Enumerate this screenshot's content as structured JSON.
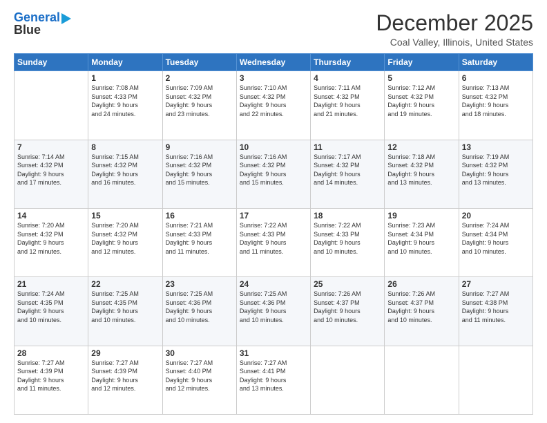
{
  "logo": {
    "line1": "General",
    "line2": "Blue"
  },
  "title": "December 2025",
  "subtitle": "Coal Valley, Illinois, United States",
  "days_header": [
    "Sunday",
    "Monday",
    "Tuesday",
    "Wednesday",
    "Thursday",
    "Friday",
    "Saturday"
  ],
  "weeks": [
    [
      {
        "day": "",
        "info": ""
      },
      {
        "day": "1",
        "info": "Sunrise: 7:08 AM\nSunset: 4:33 PM\nDaylight: 9 hours\nand 24 minutes."
      },
      {
        "day": "2",
        "info": "Sunrise: 7:09 AM\nSunset: 4:32 PM\nDaylight: 9 hours\nand 23 minutes."
      },
      {
        "day": "3",
        "info": "Sunrise: 7:10 AM\nSunset: 4:32 PM\nDaylight: 9 hours\nand 22 minutes."
      },
      {
        "day": "4",
        "info": "Sunrise: 7:11 AM\nSunset: 4:32 PM\nDaylight: 9 hours\nand 21 minutes."
      },
      {
        "day": "5",
        "info": "Sunrise: 7:12 AM\nSunset: 4:32 PM\nDaylight: 9 hours\nand 19 minutes."
      },
      {
        "day": "6",
        "info": "Sunrise: 7:13 AM\nSunset: 4:32 PM\nDaylight: 9 hours\nand 18 minutes."
      }
    ],
    [
      {
        "day": "7",
        "info": "Sunrise: 7:14 AM\nSunset: 4:32 PM\nDaylight: 9 hours\nand 17 minutes."
      },
      {
        "day": "8",
        "info": "Sunrise: 7:15 AM\nSunset: 4:32 PM\nDaylight: 9 hours\nand 16 minutes."
      },
      {
        "day": "9",
        "info": "Sunrise: 7:16 AM\nSunset: 4:32 PM\nDaylight: 9 hours\nand 15 minutes."
      },
      {
        "day": "10",
        "info": "Sunrise: 7:16 AM\nSunset: 4:32 PM\nDaylight: 9 hours\nand 15 minutes."
      },
      {
        "day": "11",
        "info": "Sunrise: 7:17 AM\nSunset: 4:32 PM\nDaylight: 9 hours\nand 14 minutes."
      },
      {
        "day": "12",
        "info": "Sunrise: 7:18 AM\nSunset: 4:32 PM\nDaylight: 9 hours\nand 13 minutes."
      },
      {
        "day": "13",
        "info": "Sunrise: 7:19 AM\nSunset: 4:32 PM\nDaylight: 9 hours\nand 13 minutes."
      }
    ],
    [
      {
        "day": "14",
        "info": "Sunrise: 7:20 AM\nSunset: 4:32 PM\nDaylight: 9 hours\nand 12 minutes."
      },
      {
        "day": "15",
        "info": "Sunrise: 7:20 AM\nSunset: 4:32 PM\nDaylight: 9 hours\nand 12 minutes."
      },
      {
        "day": "16",
        "info": "Sunrise: 7:21 AM\nSunset: 4:33 PM\nDaylight: 9 hours\nand 11 minutes."
      },
      {
        "day": "17",
        "info": "Sunrise: 7:22 AM\nSunset: 4:33 PM\nDaylight: 9 hours\nand 11 minutes."
      },
      {
        "day": "18",
        "info": "Sunrise: 7:22 AM\nSunset: 4:33 PM\nDaylight: 9 hours\nand 10 minutes."
      },
      {
        "day": "19",
        "info": "Sunrise: 7:23 AM\nSunset: 4:34 PM\nDaylight: 9 hours\nand 10 minutes."
      },
      {
        "day": "20",
        "info": "Sunrise: 7:24 AM\nSunset: 4:34 PM\nDaylight: 9 hours\nand 10 minutes."
      }
    ],
    [
      {
        "day": "21",
        "info": "Sunrise: 7:24 AM\nSunset: 4:35 PM\nDaylight: 9 hours\nand 10 minutes."
      },
      {
        "day": "22",
        "info": "Sunrise: 7:25 AM\nSunset: 4:35 PM\nDaylight: 9 hours\nand 10 minutes."
      },
      {
        "day": "23",
        "info": "Sunrise: 7:25 AM\nSunset: 4:36 PM\nDaylight: 9 hours\nand 10 minutes."
      },
      {
        "day": "24",
        "info": "Sunrise: 7:25 AM\nSunset: 4:36 PM\nDaylight: 9 hours\nand 10 minutes."
      },
      {
        "day": "25",
        "info": "Sunrise: 7:26 AM\nSunset: 4:37 PM\nDaylight: 9 hours\nand 10 minutes."
      },
      {
        "day": "26",
        "info": "Sunrise: 7:26 AM\nSunset: 4:37 PM\nDaylight: 9 hours\nand 10 minutes."
      },
      {
        "day": "27",
        "info": "Sunrise: 7:27 AM\nSunset: 4:38 PM\nDaylight: 9 hours\nand 11 minutes."
      }
    ],
    [
      {
        "day": "28",
        "info": "Sunrise: 7:27 AM\nSunset: 4:39 PM\nDaylight: 9 hours\nand 11 minutes."
      },
      {
        "day": "29",
        "info": "Sunrise: 7:27 AM\nSunset: 4:39 PM\nDaylight: 9 hours\nand 12 minutes."
      },
      {
        "day": "30",
        "info": "Sunrise: 7:27 AM\nSunset: 4:40 PM\nDaylight: 9 hours\nand 12 minutes."
      },
      {
        "day": "31",
        "info": "Sunrise: 7:27 AM\nSunset: 4:41 PM\nDaylight: 9 hours\nand 13 minutes."
      },
      {
        "day": "",
        "info": ""
      },
      {
        "day": "",
        "info": ""
      },
      {
        "day": "",
        "info": ""
      }
    ]
  ]
}
